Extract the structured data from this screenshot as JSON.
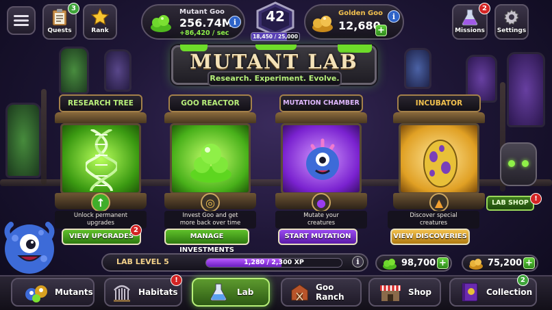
{
  "header": {
    "quests_label": "Quests",
    "quests_badge": "3",
    "rank_label": "Rank",
    "mutant_goo": {
      "name": "Mutant Goo",
      "value": "256.74M",
      "rate": "+86,420 / sec"
    },
    "level": {
      "value": "42",
      "xp": "18,450 / 25,000",
      "progress": 0.738
    },
    "golden_goo": {
      "name": "Golden Goo",
      "value": "12,680"
    },
    "missions_label": "Missions",
    "missions_badge": "2",
    "settings_label": "Settings"
  },
  "title": {
    "main": "MUTANT LAB",
    "subtitle": "Research. Experiment. Evolve."
  },
  "machines": [
    {
      "name": "RESEARCH TREE",
      "desc_line1": "Unlock permanent",
      "desc_line2": "upgrades",
      "button": "VIEW UPGRADES",
      "badge": "2"
    },
    {
      "name": "GOO REACTOR",
      "desc_line1": "Invest Goo and get",
      "desc_line2": "more back over time",
      "button": "MANAGE INVESTMENTS"
    },
    {
      "name": "MUTATION CHAMBER",
      "desc_line1": "Mutate your",
      "desc_line2": "creatures",
      "button": "START MUTATION"
    },
    {
      "name": "INCUBATOR",
      "desc_line1": "Discover special",
      "desc_line2": "creatures",
      "button": "VIEW DISCOVERIES"
    }
  ],
  "lab_shop_label": "LAB SHOP",
  "lab_level": {
    "label": "LAB LEVEL 5",
    "xp_text": "1,280 / 2,300 XP",
    "progress": 0.557
  },
  "currencies": {
    "green_goo": "98,700",
    "gold_goo": "75,200"
  },
  "nav": {
    "mutants": "Mutants",
    "habitats": "Habitats",
    "habitats_badge": "!",
    "lab": "Lab",
    "goo_ranch": "Goo Ranch",
    "shop": "Shop",
    "collection": "Collection",
    "collection_badge": "2"
  },
  "colors": {
    "goo_green": "#7be032",
    "gold": "#f2c14e",
    "purple": "#9a3cf0",
    "badge_red": "#d32424"
  }
}
